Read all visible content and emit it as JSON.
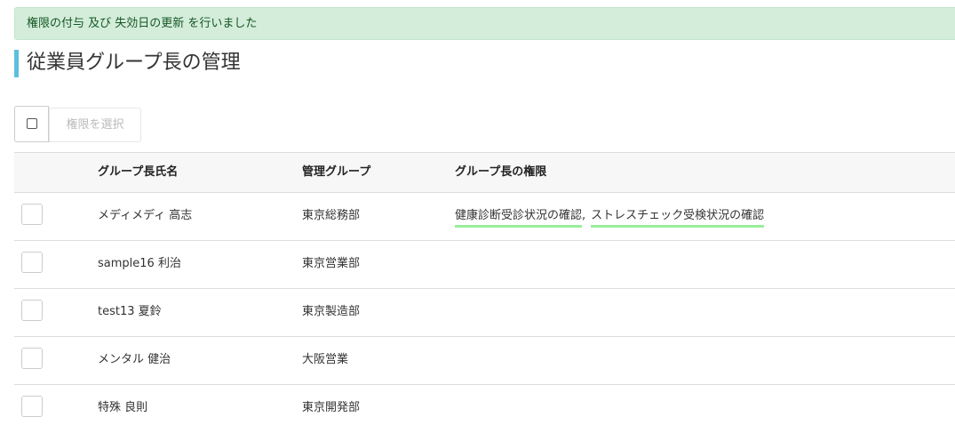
{
  "alert": {
    "message": "権限の付与 及び 失効日の更新 を行いました"
  },
  "page": {
    "title": "従業員グループ長の管理"
  },
  "toolbar": {
    "select_permission_label": "権限を選択"
  },
  "table": {
    "headers": {
      "name": "グループ長氏名",
      "group": "管理グループ",
      "permissions": "グループ長の権限"
    },
    "separator": ",",
    "rows": [
      {
        "name": "メディメディ 高志",
        "group": "東京総務部",
        "permissions": [
          "健康診断受診状況の確認",
          "ストレスチェック受検状況の確認"
        ]
      },
      {
        "name": "sample16 利治",
        "group": "東京営業部",
        "permissions": []
      },
      {
        "name": "test13 夏鈴",
        "group": "東京製造部",
        "permissions": []
      },
      {
        "name": "メンタル 健治",
        "group": "大阪営業",
        "permissions": []
      },
      {
        "name": "特殊 良則",
        "group": "東京開発部",
        "permissions": []
      }
    ]
  },
  "colors": {
    "accent": "#5bc0de",
    "alert_bg": "#d4edda",
    "alert_text": "#155724",
    "permission_underline": "#99ee99"
  }
}
